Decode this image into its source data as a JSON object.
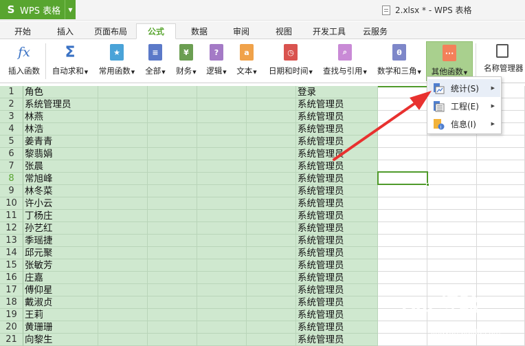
{
  "titlebar": {
    "app_button_logo": "S",
    "app_button_label": "WPS 表格",
    "doc_title": "2.xlsx * - WPS 表格"
  },
  "tabs": [
    "开始",
    "插入",
    "页面布局",
    "公式",
    "数据",
    "审阅",
    "视图",
    "开发工具",
    "云服务"
  ],
  "active_tab": "公式",
  "ribbon": {
    "insert_function": "插入函数",
    "autosum": "自动求和",
    "common_functions": "常用函数",
    "all": "全部",
    "finance": "财务",
    "logic": "逻辑",
    "text": "文本",
    "date_time": "日期和时间",
    "lookup": "查找与引用",
    "math_trig": "数学和三角",
    "other_functions": "其他函数",
    "name_manager": "名称管理器",
    "fx_glyph": "fx",
    "sigma_glyph": "Σ"
  },
  "menu": {
    "items": [
      {
        "label": "统计(S)",
        "icon": "statistics-icon"
      },
      {
        "label": "工程(E)",
        "icon": "engineering-icon"
      },
      {
        "label": "信息(I)",
        "icon": "info-icon"
      }
    ]
  },
  "sheet": {
    "rows": [
      {
        "num": "1",
        "a": "角色",
        "f": "登录"
      },
      {
        "num": "2",
        "a": "系统管理员",
        "f": "系统管理员"
      },
      {
        "num": "3",
        "a": "林燕",
        "f": "系统管理员"
      },
      {
        "num": "4",
        "a": "林浩",
        "f": "系统管理员"
      },
      {
        "num": "5",
        "a": "姜青青",
        "f": "系统管理员"
      },
      {
        "num": "6",
        "a": "黎翡娟",
        "f": "系统管理员"
      },
      {
        "num": "7",
        "a": "张晨",
        "f": "系统管理员"
      },
      {
        "num": "8",
        "a": "常旭峰",
        "f": "系统管理员"
      },
      {
        "num": "9",
        "a": "林冬菜",
        "f": "系统管理员"
      },
      {
        "num": "10",
        "a": "许小云",
        "f": "系统管理员"
      },
      {
        "num": "11",
        "a": "丁杨庄",
        "f": "系统管理员"
      },
      {
        "num": "12",
        "a": "孙艺红",
        "f": "系统管理员"
      },
      {
        "num": "13",
        "a": "季瑶捷",
        "f": "系统管理员"
      },
      {
        "num": "14",
        "a": "邱元聚",
        "f": "系统管理员"
      },
      {
        "num": "15",
        "a": "张敏芳",
        "f": "系统管理员"
      },
      {
        "num": "16",
        "a": "庄嘉",
        "f": "系统管理员"
      },
      {
        "num": "17",
        "a": "傅仰星",
        "f": "系统管理员"
      },
      {
        "num": "18",
        "a": "戴淑贞",
        "f": "系统管理员"
      },
      {
        "num": "19",
        "a": "王莉",
        "f": "系统管理员"
      },
      {
        "num": "20",
        "a": "黄珊珊",
        "f": "系统管理员"
      },
      {
        "num": "21",
        "a": "向黎生",
        "f": "系统管理员"
      }
    ],
    "active_row": "8"
  },
  "watermark": {
    "text": "Bai 经验",
    "sub": "jingyan.baidu.com"
  },
  "colors": {
    "brand_green": "#58a52f",
    "grid_green": "#cfe8cf",
    "annotation_red": "#e8312f"
  }
}
